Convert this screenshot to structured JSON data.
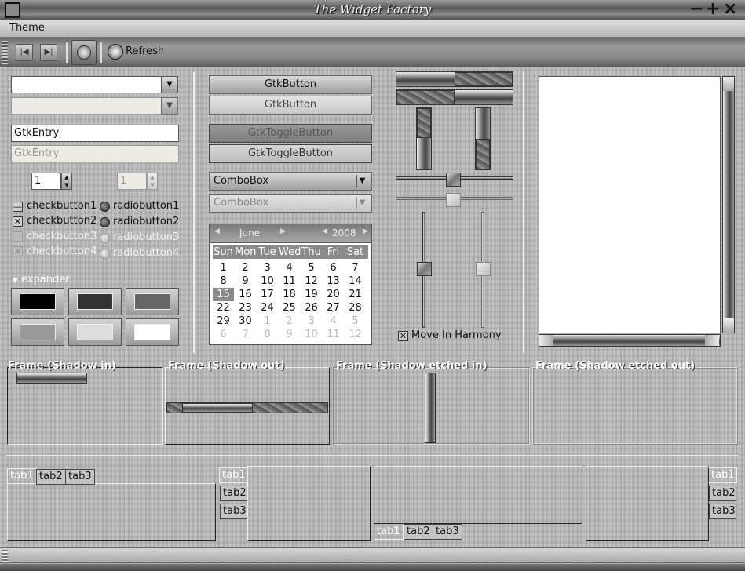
{
  "window": {
    "title": "The Widget Factory"
  },
  "menu": {
    "theme": "Theme"
  },
  "toolbar": {
    "refresh": "Refresh"
  },
  "left": {
    "entry1_value": "GtkEntry",
    "entry2_value": "GtkEntry",
    "spin1_value": "1",
    "spin2_value": "1",
    "checks": [
      "checkbutton1",
      "checkbutton2",
      "checkbutton3",
      "checkbutton4"
    ],
    "radios": [
      "radiobutton1",
      "radiobutton2",
      "radiobutton3",
      "radiobutton4"
    ],
    "expander": "expander"
  },
  "middle": {
    "button1": "GtkButton",
    "button2": "GtkButton",
    "toggle1": "GtkToggleButton",
    "toggle2": "GtkToggleButton",
    "combo1": "ComboBox",
    "combo2": "ComboBox"
  },
  "calendar": {
    "month": "June",
    "year": "2008",
    "weekdays": [
      "Sun",
      "Mon",
      "Tue",
      "Wed",
      "Thu",
      "Fri",
      "Sat"
    ],
    "weeks": [
      [
        "1",
        "2",
        "3",
        "4",
        "5",
        "6",
        "7"
      ],
      [
        "8",
        "9",
        "10",
        "11",
        "12",
        "13",
        "14"
      ],
      [
        "15",
        "16",
        "17",
        "18",
        "19",
        "20",
        "21"
      ],
      [
        "22",
        "23",
        "24",
        "25",
        "26",
        "27",
        "28"
      ],
      [
        "29",
        "30",
        "1",
        "2",
        "3",
        "4",
        "5"
      ],
      [
        "6",
        "7",
        "8",
        "9",
        "10",
        "11",
        "12"
      ]
    ],
    "selected": "15"
  },
  "scales": {
    "harmony_label": "Move In Harmony"
  },
  "frames": {
    "shadow_in": "Frame (Shadow in)",
    "shadow_out": "Frame (Shadow out)",
    "etched_in": "Frame (Shadow etched in)",
    "etched_out": "Frame (Shadow etched out)"
  },
  "notebooks": {
    "tabs": [
      "tab1",
      "tab2",
      "tab3"
    ]
  }
}
